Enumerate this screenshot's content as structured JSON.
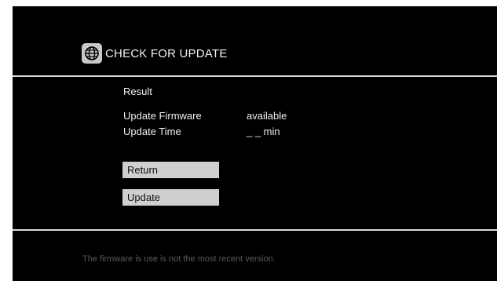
{
  "header": {
    "icon": "globe-icon",
    "title": "CHECK FOR UPDATE"
  },
  "result": {
    "section_title": "Result",
    "rows": [
      {
        "label": "Update Firmware",
        "value": "available"
      },
      {
        "label": "Update Time",
        "value": "_ _ min"
      }
    ]
  },
  "buttons": {
    "return_label": "Return",
    "update_label": "Update"
  },
  "status": {
    "message": "The firmware is use is not the most recent version."
  },
  "colors": {
    "background": "#000000",
    "text": "#f0f0f0",
    "button": "#cfcfcf",
    "status_text": "#5a5a5a"
  }
}
